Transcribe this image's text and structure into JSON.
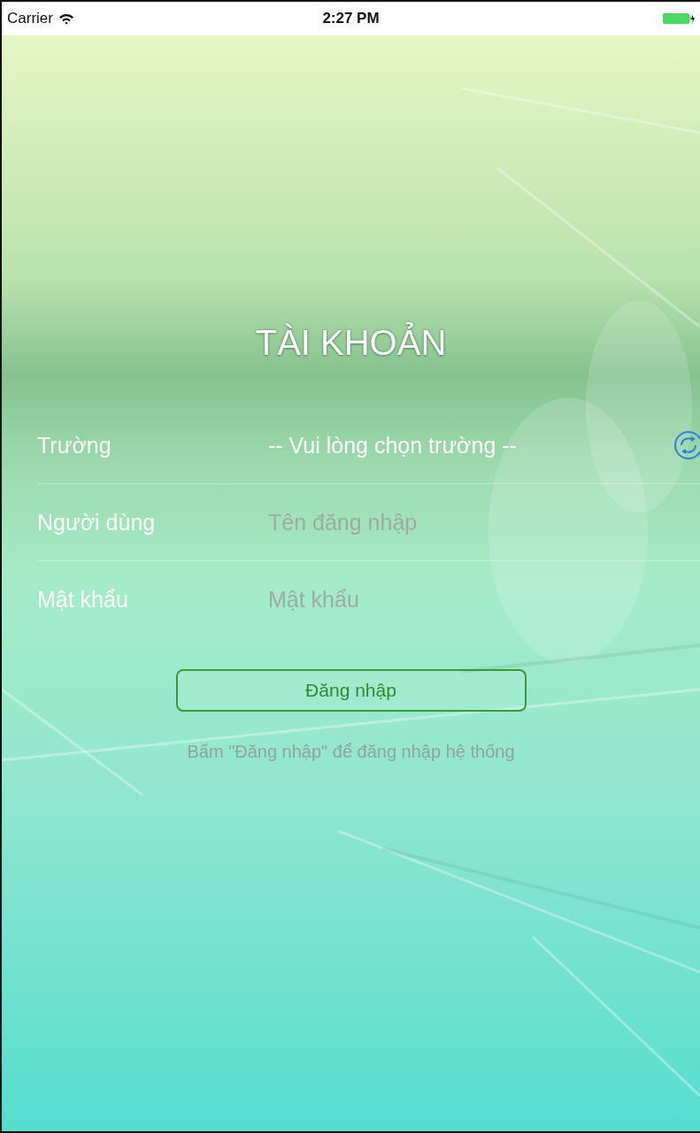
{
  "status_bar": {
    "carrier": "Carrier",
    "time": "2:27 PM"
  },
  "title": "TÀI KHOẢN",
  "fields": [
    {
      "kind": "picker",
      "label": "Trường",
      "value": "-- Vui lòng chọn trường --"
    },
    {
      "kind": "text",
      "label": "Người dùng",
      "placeholder": "Tên đăng nhập"
    },
    {
      "kind": "text",
      "label": "Mật khẩu",
      "placeholder": "Mật khẩu"
    }
  ],
  "login_button": "Đăng nhập",
  "hint": "Bấm \"Đăng nhập\" để đăng nhập hệ thống"
}
